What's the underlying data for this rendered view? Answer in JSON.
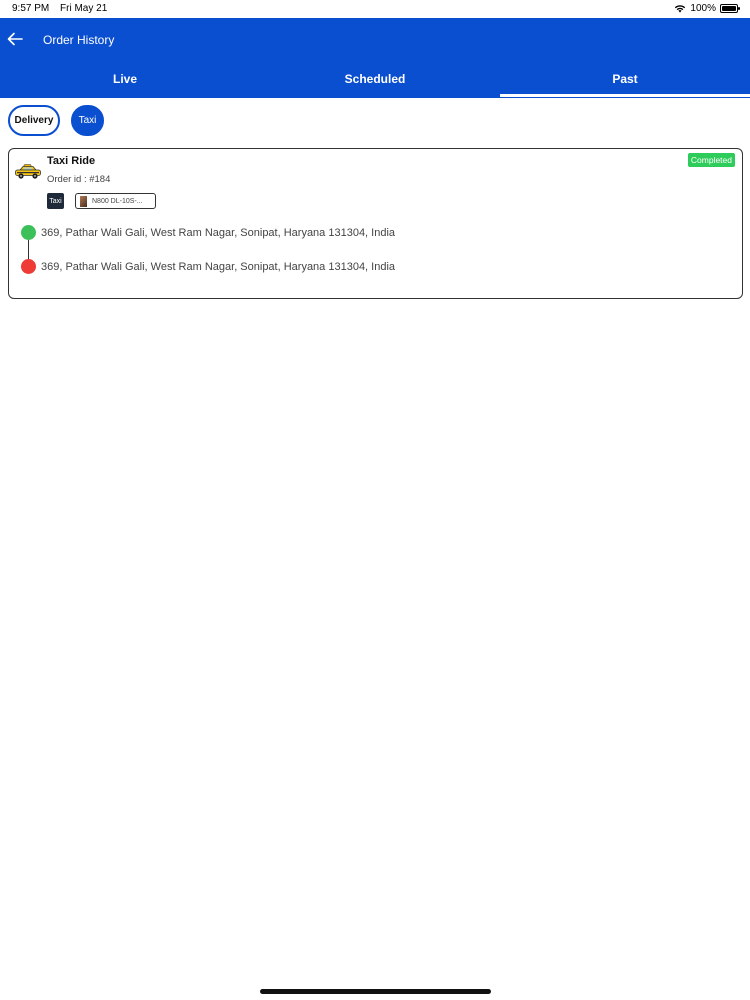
{
  "status_bar": {
    "time": "9:57 PM",
    "date": "Fri May 21",
    "battery": "100%"
  },
  "header": {
    "title": "Order History"
  },
  "tabs": [
    {
      "label": "Live"
    },
    {
      "label": "Scheduled"
    },
    {
      "label": "Past",
      "active": true
    }
  ],
  "filters": [
    {
      "label": "Delivery",
      "selected": false
    },
    {
      "label": "Taxi",
      "selected": true
    }
  ],
  "orders": [
    {
      "title": "Taxi Ride",
      "order_id": "Order id : #184",
      "status": "Completed",
      "type_tag": "Taxi",
      "vehicle": "N800 DL-10S-...",
      "pickup": "369, Pathar Wali Gali, West Ram Nagar, Sonipat, Haryana 131304, India",
      "dropoff": "369, Pathar Wali Gali, West Ram Nagar, Sonipat, Haryana 131304, India"
    }
  ],
  "colors": {
    "brand": "#0a4fd0",
    "completed": "#2ecc5a",
    "pickup": "#3cc15a",
    "dropoff": "#ee3b36"
  }
}
